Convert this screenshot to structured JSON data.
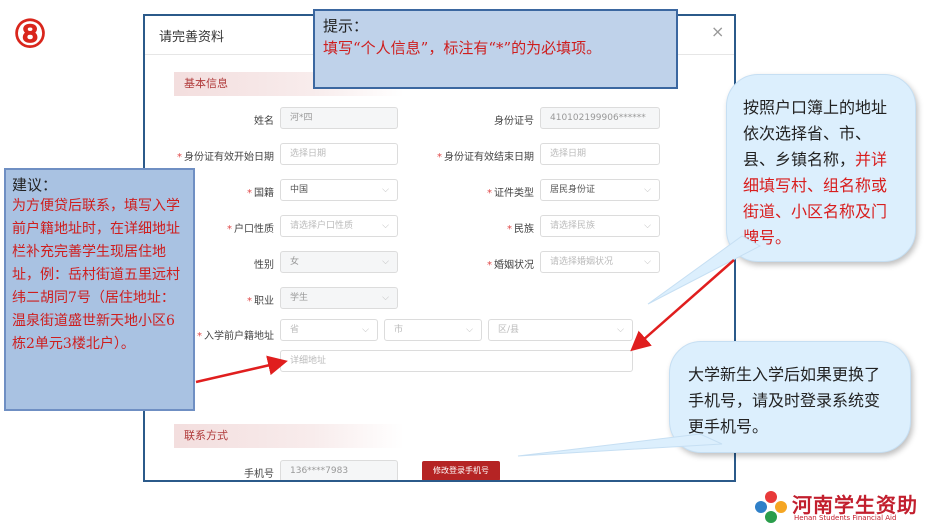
{
  "step_badge": "⑧",
  "dialog": {
    "title": "请完善资料",
    "close": "×",
    "section_basic": "基本信息",
    "section_contact": "联系方式",
    "rows": [
      {
        "label": "姓名",
        "required": false,
        "value": "河*四",
        "disabled": true,
        "select": false
      },
      {
        "label": "身份证号",
        "required": false,
        "value": "410102199906******",
        "disabled": true,
        "select": false
      },
      {
        "label": "身份证有效开始日期",
        "required": true,
        "placeholder": "选择日期",
        "disabled": false,
        "select": false
      },
      {
        "label": "身份证有效结束日期",
        "required": true,
        "placeholder": "选择日期",
        "disabled": false,
        "select": false
      },
      {
        "label": "国籍",
        "required": true,
        "value": "中国",
        "disabled": false,
        "select": true
      },
      {
        "label": "证件类型",
        "required": true,
        "value": "居民身份证",
        "disabled": false,
        "select": true
      },
      {
        "label": "户口性质",
        "required": true,
        "placeholder": "请选择户口性质",
        "disabled": false,
        "select": true
      },
      {
        "label": "民族",
        "required": true,
        "placeholder": "请选择民族",
        "disabled": false,
        "select": true
      },
      {
        "label": "性别",
        "required": false,
        "value": "女",
        "disabled": true,
        "select": true
      },
      {
        "label": "婚姻状况",
        "required": true,
        "placeholder": "请选择婚姻状况",
        "disabled": false,
        "select": true
      },
      {
        "label": "职业",
        "required": true,
        "value": "学生",
        "disabled": true,
        "select": true
      }
    ],
    "address": {
      "label": "入学前户籍地址",
      "province": "省",
      "city": "市",
      "district": "区/县",
      "detail_placeholder": "详细地址"
    },
    "phone": {
      "label": "手机号",
      "value": "136****7983",
      "button": "修改登录手机号"
    }
  },
  "hint": {
    "title": "提示：",
    "body": "填写“个人信息”，标注有“*”的为必填项。"
  },
  "suggestion": {
    "title": "建议：",
    "body": "为方便贷后联系，填写入学前户籍地址时，在详细地址栏补充完善学生现居住地址，例：岳村街道五里远村纬二胡同7号（居住地址：温泉街道盛世新天地小区6栋2单元3楼北户）。"
  },
  "bubble_address": {
    "normal": "按照户口簿上的地址依次选择省、市、县、乡镇名称，",
    "highlight": "并详细填写村、组名称或街道、小区名称及门牌号。"
  },
  "bubble_phone": "大学新生入学后如果更换了手机号，请及时登录系统变更手机号。",
  "logo": {
    "name": "河南学生资助",
    "subtitle": "Henan Students Financial Aid",
    "colors": [
      "#e83a3a",
      "#f5a623",
      "#2a9d4b",
      "#2f80c8"
    ]
  }
}
